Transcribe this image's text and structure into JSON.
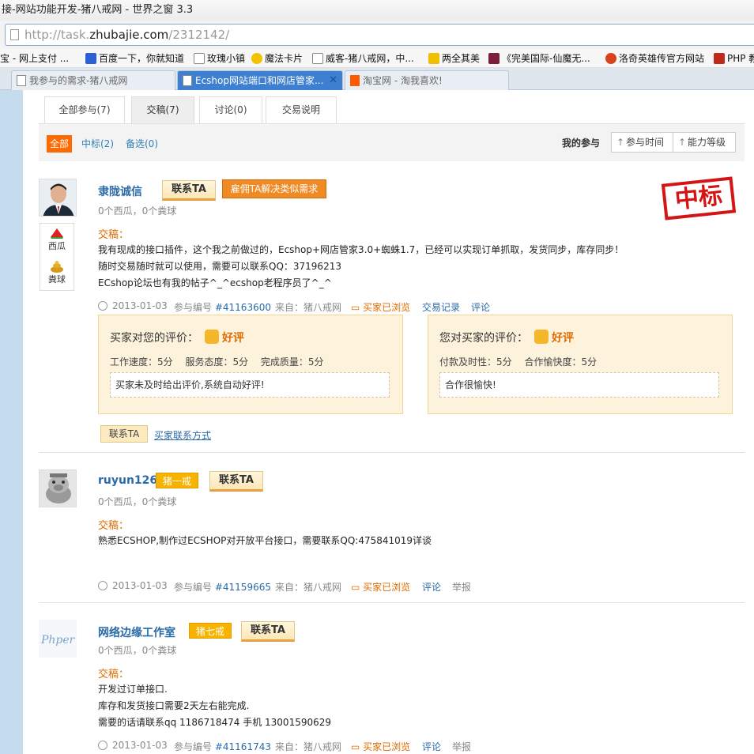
{
  "browser": {
    "window_title": "接-网站功能开发-猪八戒网 - 世界之窗 3.3",
    "url_prefix": "http://task.",
    "url_domain": "zhubajie.com",
    "url_path": "/2312142/",
    "bookmarks": [
      {
        "label": "宝 - 网上支付 ...",
        "icon": "none"
      },
      {
        "label": "百度一下，你就知道",
        "icon": "paw-icon"
      },
      {
        "label": "玫瑰小镇",
        "icon": "page-icon"
      },
      {
        "label": "魔法卡片",
        "icon": "qq-icon"
      },
      {
        "label": "威客-猪八戒网，中...",
        "icon": "page-icon"
      },
      {
        "label": "两全其美",
        "icon": "bird-icon"
      },
      {
        "label": "《完美国际-仙魔无...",
        "icon": "game-icon"
      },
      {
        "label": "洛奇英雄传官方网站",
        "icon": "mabinogi-icon"
      },
      {
        "label": "PHP 教",
        "icon": "w3-icon"
      }
    ],
    "tabs": [
      {
        "label": "我参与的需求-猪八戒网",
        "active": false
      },
      {
        "label": "Ecshop网站端口和网店管家...",
        "active": true
      },
      {
        "label": "淘宝网 - 淘我喜欢!",
        "active": false
      }
    ],
    "tab_close": "✕"
  },
  "page_tabs": [
    "全部参与(7)",
    "交稿(7)",
    "讨论(0)",
    "交易说明"
  ],
  "filters": {
    "all": "全部",
    "winner": "中标(2)",
    "shortlist": "备选(0)",
    "my_part": "我的参与",
    "sort_time": "参与时间",
    "sort_level": "能力等级"
  },
  "common": {
    "contact": "联系TA",
    "gao_label": "交稿：",
    "melon_line": "0个西瓜，0个粪球",
    "date": "2013-01-03",
    "num_prefix": "参与编号",
    "from": "来自：猪八戒网",
    "viewed": "买家已浏览",
    "trade_log": "交易记录",
    "comment": "评论",
    "report": "举报"
  },
  "entries": [
    {
      "name": "隶陇诚信",
      "hire": "雇佣TA解决类似需求",
      "stamp": "中标",
      "gifts": [
        "西瓜",
        "粪球"
      ],
      "desc": [
        "我有现成的接口插件，这个我之前做过的，Ecshop+网店管家3.0+蜘蛛1.7，已经可以实现订单抓取，发货同步，库存同步！",
        "随时交易随时就可以使用，需要可以联系QQ：37196213",
        "ECshop论坛也有我的帖子^_^ecshop老程序员了^_^"
      ],
      "num": "#41163600",
      "eval_buyer": {
        "title": "买家对您的评价：",
        "rating": "好评",
        "scores": "工作速度：5分　 服务态度：5分　 完成质量：5分",
        "comment": "买家未及时给出评价,系统自动好评!"
      },
      "eval_self": {
        "title": "您对买家的评价：",
        "rating": "好评",
        "scores": "付款及时性：5分　 合作愉快度：5分",
        "comment": "合作很愉快!"
      },
      "contact_small": "联系TA",
      "buyer_contact": "买家联系方式"
    },
    {
      "name": "ruyun126",
      "rank": "猪一戒",
      "desc": [
        "熟悉ECSHOP,制作过ECSHOP对开放平台接口，需要联系QQ:475841019详谈"
      ],
      "num": "#41159665"
    },
    {
      "name": "网络边缘工作室",
      "rank": "猪七戒",
      "avatar_text": "Phper",
      "desc": [
        "开发过订单接口.",
        "库存和发货接口需要2天左右能完成.",
        "需要的话请联系qq 1186718474 手机 13001590629"
      ],
      "num": "#41161743"
    }
  ]
}
